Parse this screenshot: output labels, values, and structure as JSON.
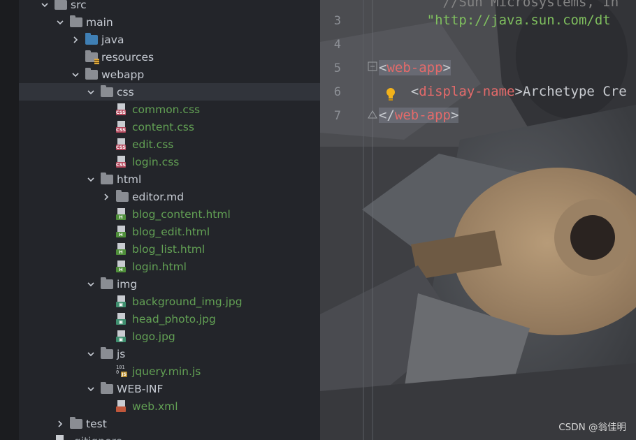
{
  "tree": [
    {
      "label": "src",
      "depth": 1,
      "arrow": "down",
      "icon": "folder",
      "color": "normal"
    },
    {
      "label": "main",
      "depth": 2,
      "arrow": "down",
      "icon": "folder",
      "color": "normal"
    },
    {
      "label": "java",
      "depth": 3,
      "arrow": "right",
      "icon": "folder-blue",
      "color": "normal"
    },
    {
      "label": "resources",
      "depth": 3,
      "arrow": "none",
      "icon": "folder-resources",
      "color": "normal"
    },
    {
      "label": "webapp",
      "depth": 3,
      "arrow": "down",
      "icon": "folder",
      "color": "normal"
    },
    {
      "label": "css",
      "depth": 4,
      "arrow": "down",
      "icon": "folder",
      "color": "normal",
      "selected": true
    },
    {
      "label": "common.css",
      "depth": 5,
      "arrow": "none",
      "icon": "css",
      "color": "green"
    },
    {
      "label": "content.css",
      "depth": 5,
      "arrow": "none",
      "icon": "css",
      "color": "green"
    },
    {
      "label": "edit.css",
      "depth": 5,
      "arrow": "none",
      "icon": "css",
      "color": "green"
    },
    {
      "label": "login.css",
      "depth": 5,
      "arrow": "none",
      "icon": "css",
      "color": "green"
    },
    {
      "label": "html",
      "depth": 4,
      "arrow": "down",
      "icon": "folder",
      "color": "normal"
    },
    {
      "label": "editor.md",
      "depth": 5,
      "arrow": "right",
      "icon": "folder",
      "color": "normal"
    },
    {
      "label": "blog_content.html",
      "depth": 5,
      "arrow": "none",
      "icon": "html",
      "color": "green"
    },
    {
      "label": "blog_edit.html",
      "depth": 5,
      "arrow": "none",
      "icon": "html",
      "color": "green"
    },
    {
      "label": "blog_list.html",
      "depth": 5,
      "arrow": "none",
      "icon": "html",
      "color": "green"
    },
    {
      "label": "login.html",
      "depth": 5,
      "arrow": "none",
      "icon": "html",
      "color": "green"
    },
    {
      "label": "img",
      "depth": 4,
      "arrow": "down",
      "icon": "folder",
      "color": "normal"
    },
    {
      "label": "background_img.jpg",
      "depth": 5,
      "arrow": "none",
      "icon": "image",
      "color": "green"
    },
    {
      "label": "head_photo.jpg",
      "depth": 5,
      "arrow": "none",
      "icon": "image",
      "color": "green"
    },
    {
      "label": "logo.jpg",
      "depth": 5,
      "arrow": "none",
      "icon": "image",
      "color": "green"
    },
    {
      "label": "js",
      "depth": 4,
      "arrow": "down",
      "icon": "folder",
      "color": "normal"
    },
    {
      "label": "jquery.min.js",
      "depth": 5,
      "arrow": "none",
      "icon": "js",
      "color": "green"
    },
    {
      "label": "WEB-INF",
      "depth": 4,
      "arrow": "down",
      "icon": "folder",
      "color": "normal"
    },
    {
      "label": "web.xml",
      "depth": 5,
      "arrow": "none",
      "icon": "xml",
      "color": "green"
    },
    {
      "label": "test",
      "depth": 2,
      "arrow": "right",
      "icon": "folder",
      "color": "normal"
    },
    {
      "label": ".gitignore",
      "depth": 1,
      "arrow": "none",
      "icon": "file",
      "color": "grey"
    }
  ],
  "editor": {
    "lines": [
      {
        "num": "",
        "parts": [
          {
            "t": "        //Sun Microsystems, In",
            "c": "comment"
          }
        ]
      },
      {
        "num": "3",
        "parts": [
          {
            "t": "      \"http://java.sun.com/dt",
            "c": "strgreen"
          }
        ]
      },
      {
        "num": "4",
        "parts": []
      },
      {
        "num": "5",
        "parts": [
          {
            "t": "<",
            "c": "punct",
            "hl": true
          },
          {
            "t": "web-app",
            "c": "tag-red",
            "hl": true
          },
          {
            "t": ">",
            "c": "punct",
            "hl": true
          }
        ]
      },
      {
        "num": "6",
        "parts": [
          {
            "t": "    <",
            "c": "punct"
          },
          {
            "t": "display-name",
            "c": "tag-red"
          },
          {
            "t": ">Archetype Cre",
            "c": "punct"
          }
        ]
      },
      {
        "num": "7",
        "parts": [
          {
            "t": "</",
            "c": "punct",
            "hl": true
          },
          {
            "t": "web-app",
            "c": "tag-red",
            "hl": true
          },
          {
            "t": ">",
            "c": "punct",
            "hl": true
          }
        ]
      }
    ]
  },
  "watermark": "CSDN @翁佳明",
  "colors": {
    "tree_bg": "#23252a",
    "selected": "#31343b",
    "green_file": "#62a054",
    "xml_tag": "#e46a6a"
  }
}
